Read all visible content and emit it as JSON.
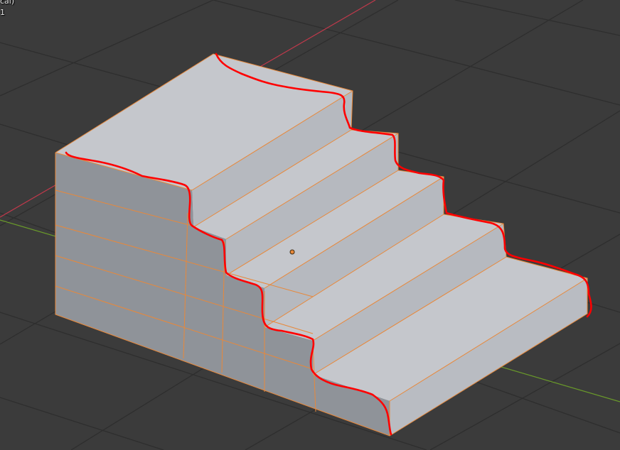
{
  "viewport": {
    "view_name": "cal)",
    "object_info": "1",
    "colors": {
      "background": "#3b3b3b",
      "grid_line": "#2e2e2e",
      "x_axis": "#c0394b",
      "y_axis": "#6a9a2a",
      "top_face": "#c5c7cc",
      "side_face": "#8f9399",
      "riser_face": "#b3b6bc",
      "selected_edge": "#e8883a",
      "annotation": "#ff0000",
      "origin": "#e8883a"
    }
  }
}
